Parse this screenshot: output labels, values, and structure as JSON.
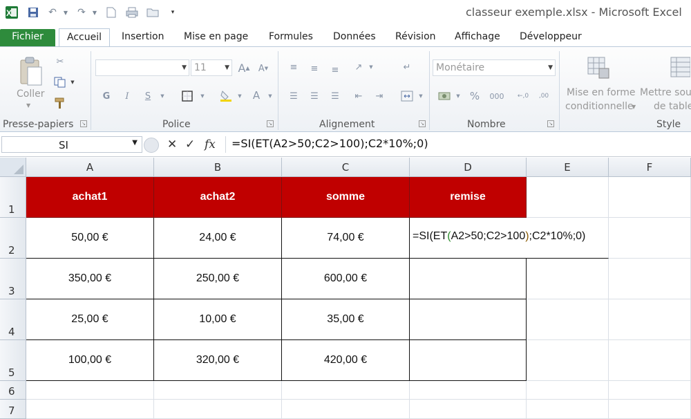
{
  "window": {
    "title": "classeur exemple.xlsx  -  Microsoft Excel"
  },
  "ribbon_tabs": [
    "Fichier",
    "Accueil",
    "Insertion",
    "Mise en page",
    "Formules",
    "Données",
    "Révision",
    "Affichage",
    "Développeur"
  ],
  "ribbon": {
    "clipboard": {
      "paste_label": "Coller",
      "group_label": "Presse-papiers"
    },
    "font": {
      "font_name": "",
      "font_size": "11",
      "group_label": "Police"
    },
    "alignment": {
      "group_label": "Alignement"
    },
    "number": {
      "format": "Monétaire",
      "group_label": "Nombre"
    },
    "styles": {
      "conditional_line1": "Mise en forme",
      "conditional_line2": "conditionnelle",
      "table_line1": "Mettre sou",
      "table_line2": "de table",
      "group_label": "Style"
    }
  },
  "formula_bar": {
    "name_box": "SI",
    "formula": "=SI(ET(A2>50;C2>100);C2*10%;0)"
  },
  "sheet": {
    "columns": [
      "A",
      "B",
      "C",
      "D",
      "E",
      "F"
    ],
    "rows": [
      "1",
      "2",
      "3",
      "4",
      "5",
      "6",
      "7"
    ],
    "header_row": [
      "achat1",
      "achat2",
      "somme",
      "remise"
    ],
    "data_rows": [
      [
        "50,00 €",
        "24,00 €",
        "74,00 €"
      ],
      [
        "350,00 €",
        "250,00 €",
        "600,00 €"
      ],
      [
        "25,00 €",
        "10,00 €",
        "35,00 €"
      ],
      [
        "100,00 €",
        "320,00 €",
        "420,00 €"
      ]
    ],
    "editing_cell_text": {
      "p1": "=SI(ET",
      "p2": "(",
      "p3": "A2>50;C2>100",
      "p4": ")",
      "p5": ";C2*10%;0)"
    },
    "header_fill": "#c00000"
  },
  "colors": {
    "file_tab": "#2e8b3c",
    "header_fill": "#c00000"
  }
}
